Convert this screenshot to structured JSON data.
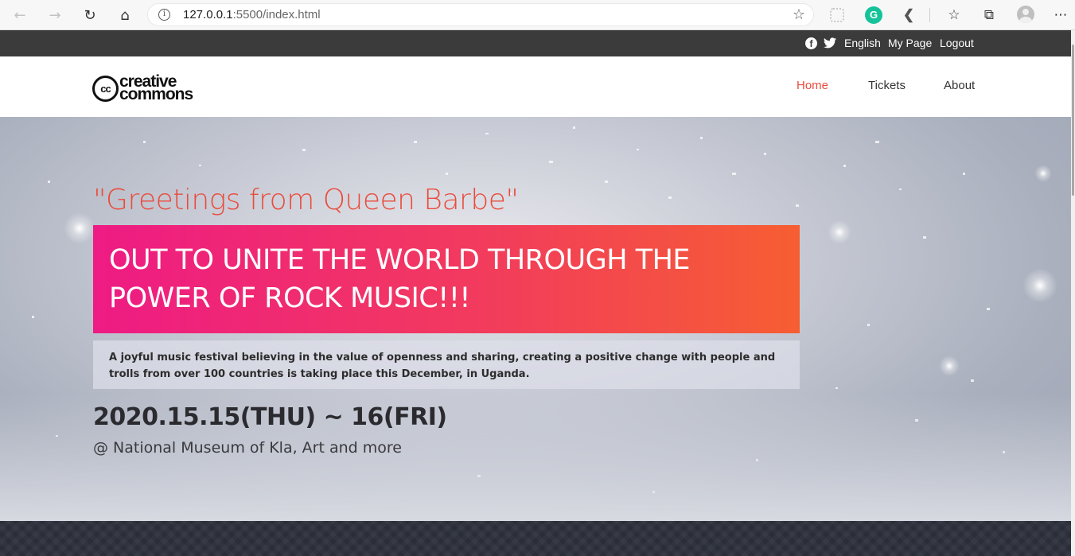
{
  "browser": {
    "url_host": "127.0.0.1",
    "url_rest": ":5500/index.html",
    "icons": [
      "back-icon",
      "forward-icon",
      "refresh-icon",
      "home-icon",
      "info-icon",
      "favorite-star-icon",
      "extension-icon",
      "grammarly-icon",
      "k-extension-icon",
      "favorites-icon",
      "collections-icon",
      "profile-icon",
      "more-icon"
    ]
  },
  "topbar": {
    "language": "English",
    "my_page": "My Page",
    "logout": "Logout",
    "facebook_glyph": "f"
  },
  "header": {
    "logo_cc": "cc",
    "logo_line1": "creative",
    "logo_line2": "commons",
    "nav": {
      "home": "Home",
      "tickets": "Tickets",
      "about": "About"
    },
    "active_color": "#ea4c3c"
  },
  "hero": {
    "greeting": "\"Greetings from Queen Barbe\"",
    "headline_line1": "OUT TO UNITE THE WORLD THROUGH THE",
    "headline_line2": "POWER OF ROCK MUSIC!!!",
    "description": "A joyful music festival believing in the value of openness and sharing, creating a positive change with people and trolls from over 100 countries is taking place this December, in Uganda.",
    "date": "2020.15.15(THU) ~ 16(FRI)",
    "venue": "@ National Museum of Kla, Art and more",
    "banner_colors": [
      "#ee1b84",
      "#f65e32"
    ]
  }
}
